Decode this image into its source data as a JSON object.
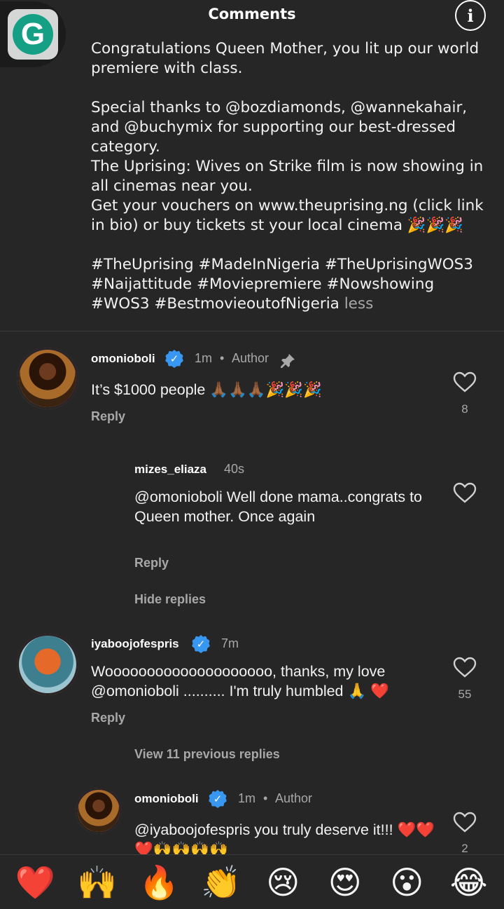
{
  "header": {
    "title": "Comments",
    "info_label": "i"
  },
  "floating_app": {
    "letter": "G"
  },
  "caption": {
    "text": "Congratulations Queen Mother, you lit up our world premiere with class.\n\nSpecial thanks to @bozdiamonds, @wannekahair, and @buchymix for supporting our best-dressed category.\nThe Uprising: Wives on Strike film is now showing in all cinemas near you.\nGet your vouchers on www.theuprising.ng (click link in bio) or buy tickets st your local cinema 🎉🎉🎉\n\n#TheUprising #MadeInNigeria #TheUprisingWOS3 #Naijattitude #Moviepremiere #Nowshowing #WOS3 #BestmovieoutofNigeria ",
    "less_label": "less"
  },
  "comments": [
    {
      "username": "omonioboli",
      "verified": true,
      "time": "1m",
      "badge": "Author",
      "text": "It’s $1000 people 🙏🏾🙏🏾🙏🏾🎉🎉🎉",
      "reply_label": "Reply",
      "likes": "8"
    },
    {
      "username": "mizes_eliaza",
      "verified": false,
      "time": "40s",
      "text": "@omonioboli Well done mama..congrats to Queen mother. Once again",
      "reply_label": "Reply",
      "hide_replies_label": "Hide replies"
    },
    {
      "username": "iyaboojofespris",
      "verified": true,
      "time": "7m",
      "text": "Woooooooooooooooooooo, thanks, my love @omonioboli .......... I'm truly humbled 🙏 ❤️",
      "reply_label": "Reply",
      "likes": "55",
      "view_previous_label": "View 11 previous replies"
    },
    {
      "username": "omonioboli",
      "verified": true,
      "time": "1m",
      "badge": "Author",
      "text": "@iyaboojofespris you truly deserve it!!! ❤️❤️❤️🙌🙌🙌🙌",
      "likes": "2"
    }
  ],
  "meta_separator": "•",
  "reactions": [
    "❤️",
    "🙌",
    "🔥",
    "👏",
    "😢",
    "😍",
    "😮",
    "😂"
  ],
  "colors": {
    "background": "#262626",
    "muted": "#a8a8a8",
    "verified": "#3897f0"
  }
}
